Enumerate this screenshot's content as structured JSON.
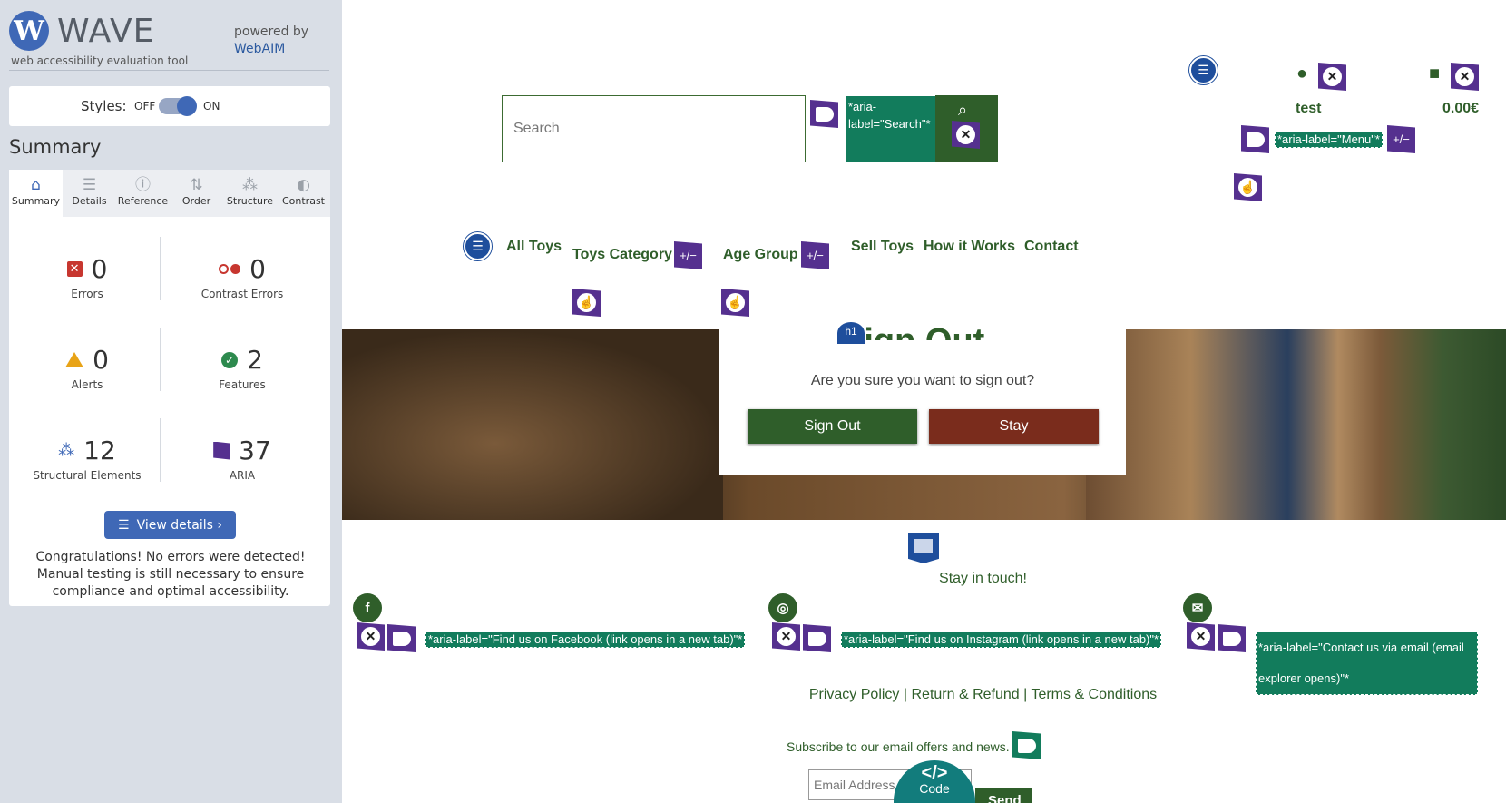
{
  "wave": {
    "logo_mark": "W",
    "logo_text": "WAVE",
    "logo_sub": "web accessibility evaluation tool",
    "powered_by": "powered by",
    "powered_link": "WebAIM",
    "styles_label": "Styles:",
    "styles_off": "OFF",
    "styles_on": "ON",
    "styles_enabled": true,
    "summary_title": "Summary",
    "tabs": [
      {
        "label": "Summary",
        "icon": "home-icon",
        "glyph": "⌂"
      },
      {
        "label": "Details",
        "icon": "list-icon",
        "glyph": "☰"
      },
      {
        "label": "Reference",
        "icon": "info-icon",
        "glyph": "ⓘ"
      },
      {
        "label": "Order",
        "icon": "order-icon",
        "glyph": "⇅"
      },
      {
        "label": "Structure",
        "icon": "structure-icon",
        "glyph": "⁂"
      },
      {
        "label": "Contrast",
        "icon": "contrast-icon",
        "glyph": "◐"
      }
    ],
    "stats": {
      "errors": {
        "value": "0",
        "label": "Errors"
      },
      "contrast_errors": {
        "value": "0",
        "label": "Contrast Errors"
      },
      "alerts": {
        "value": "0",
        "label": "Alerts"
      },
      "features": {
        "value": "2",
        "label": "Features"
      },
      "structural": {
        "value": "12",
        "label": "Structural Elements"
      },
      "aria": {
        "value": "37",
        "label": "ARIA"
      }
    },
    "view_details": "View details ›",
    "congrats": "Congratulations! No errors were detected! Manual testing is still necessary to ensure compliance and optimal accessibility."
  },
  "site": {
    "search_placeholder": "Search",
    "search_aria": "*aria-label=\"Search\"*",
    "menu_aria": "*aria-label=\"Menu\"*",
    "user_name": "test",
    "cart_total": "0.00€",
    "nav": [
      "All Toys",
      "Toys Category",
      "Age Group",
      "Sell Toys",
      "How it Works",
      "Contact"
    ],
    "plus_minus": "+/−",
    "h1_badge": "h1",
    "signout_title": "Sign Out",
    "signout_question": "Are you sure you want to sign out?",
    "btn_signout": "Sign Out",
    "btn_stay": "Stay",
    "stay_in_touch": "Stay in touch!",
    "social": [
      {
        "icon": "facebook-icon",
        "glyph": "f",
        "aria": "*aria-label=\"Find us on Facebook (link opens in a new tab)\"*"
      },
      {
        "icon": "instagram-icon",
        "glyph": "◎",
        "aria": "*aria-label=\"Find us on Instagram (link opens in a new tab)\"*"
      },
      {
        "icon": "email-icon",
        "glyph": "✉",
        "aria": "*aria-label=\"Contact us via email (email explorer opens)\"*"
      }
    ],
    "footer_links": [
      "Privacy Policy",
      "Return & Refund",
      "Terms & Conditions"
    ],
    "footer_sep": "|",
    "subscribe_text": "Subscribe to our email offers and news.",
    "email_placeholder": "Email Address",
    "send_label": "Send",
    "code_glyph": "</>",
    "code_label": "Code"
  },
  "colors": {
    "wave_blue": "#3f68b6",
    "site_green": "#2f5e2a",
    "aria_purple": "#55308f",
    "aria_label_green": "#127c5c",
    "stay_red": "#7a2c1c"
  }
}
